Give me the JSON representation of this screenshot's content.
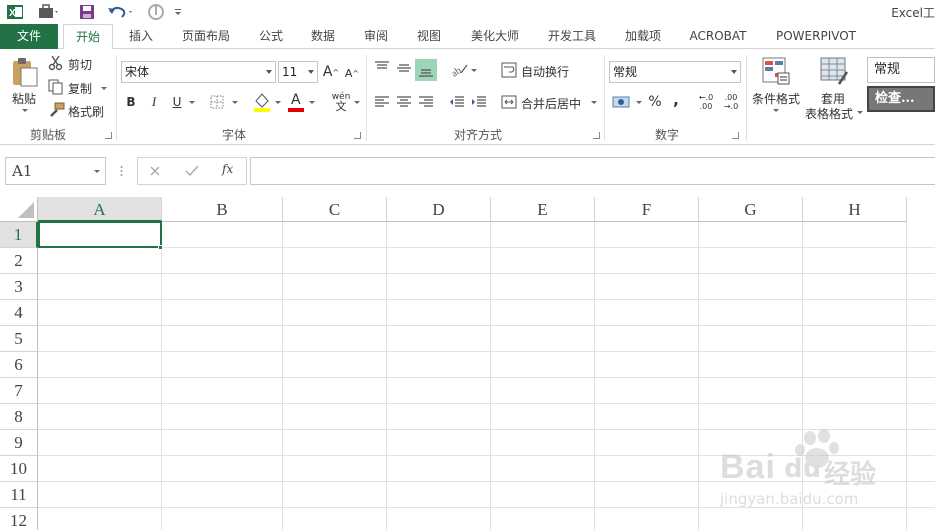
{
  "title": "Excel工",
  "qat": {
    "icons": [
      "excel-icon",
      "briefcase-icon",
      "save-icon",
      "undo-icon",
      "redo-icon",
      "customize-icon"
    ]
  },
  "tabs": [
    {
      "label": "文件"
    },
    {
      "label": "开始"
    },
    {
      "label": "插入"
    },
    {
      "label": "页面布局"
    },
    {
      "label": "公式"
    },
    {
      "label": "数据"
    },
    {
      "label": "审阅"
    },
    {
      "label": "视图"
    },
    {
      "label": "美化大师"
    },
    {
      "label": "开发工具"
    },
    {
      "label": "加载项"
    },
    {
      "label": "ACROBAT"
    },
    {
      "label": "POWERPIVOT"
    }
  ],
  "ribbon": {
    "clipboard": {
      "group": "剪贴板",
      "paste": "粘贴",
      "cut": "剪切",
      "copy": "复制",
      "format_painter": "格式刷"
    },
    "font": {
      "group": "字体",
      "font_name": "宋体",
      "font_size": "11",
      "bold": "B",
      "italic": "I",
      "underline": "U",
      "grow": "A",
      "shrink": "A",
      "font_color": "A",
      "phonetic": "wén"
    },
    "alignment": {
      "group": "对齐方式",
      "wrap": "自动换行",
      "merge": "合并后居中"
    },
    "number": {
      "group": "数字",
      "format": "常规",
      "percent": "%",
      "comma": ",",
      "inc_decimal": ".00",
      "dec_decimal": ".00"
    },
    "styles": {
      "conditional": "条件格式",
      "table_format_1": "套用",
      "table_format_2": "表格格式",
      "style_normal": "常规",
      "style_check": "检查..."
    }
  },
  "formula_bar": {
    "name_box": "A1",
    "fx": "fx",
    "value": ""
  },
  "columns": [
    "A",
    "B",
    "C",
    "D",
    "E",
    "F",
    "G",
    "H"
  ],
  "rows": [
    "1",
    "2",
    "3",
    "4",
    "5",
    "6",
    "7",
    "8",
    "9",
    "10",
    "11",
    "12"
  ],
  "active_cell": "A1",
  "watermark": {
    "brand": "Bai",
    "brand_cn": "经验",
    "url": "jingyan.baidu.com"
  },
  "colors": {
    "accent": "#217346",
    "font_color_bar": "#e00000",
    "highlight_bar": "#ffff00"
  }
}
